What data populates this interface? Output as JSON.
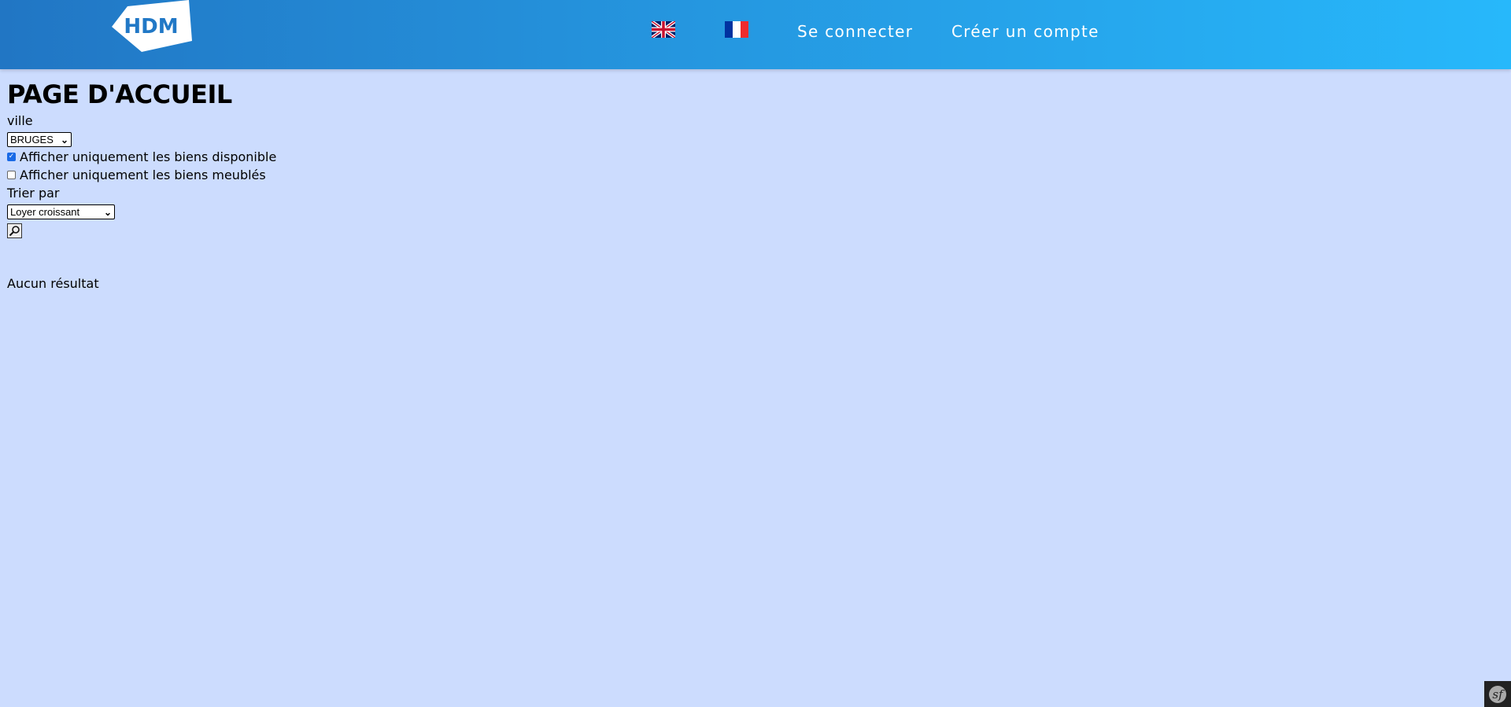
{
  "header": {
    "logo_text": "HDM",
    "flags": [
      {
        "name": "english-flag"
      },
      {
        "name": "french-flag"
      }
    ],
    "login_label": "Se connecter",
    "register_label": "Créer un compte"
  },
  "main": {
    "title": "PAGE D'ACCUEIL",
    "city_label": "ville",
    "city_selected": "BRUGES",
    "available_label": "Afficher uniquement les biens disponible",
    "available_checked": true,
    "furnished_label": "Afficher uniquement les biens meublés",
    "furnished_checked": false,
    "sort_label": "Trier par",
    "sort_selected": "Loyer croissant",
    "search_icon": "search-icon",
    "no_result": "Aucun résultat"
  },
  "colors": {
    "background": "#ccdcfe",
    "header_start": "#2176c4",
    "header_end": "#27b8fb"
  }
}
